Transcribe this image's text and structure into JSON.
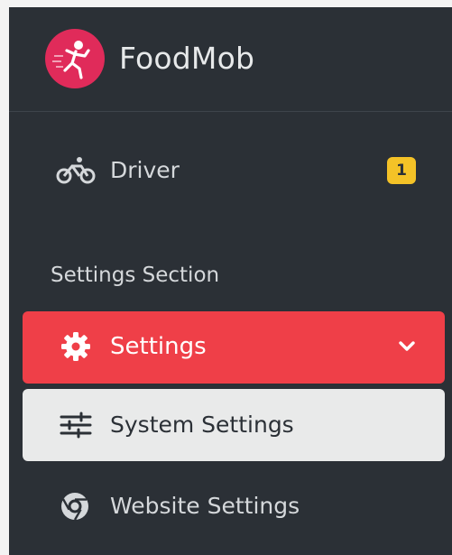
{
  "brand": {
    "name": "FoodMob",
    "logo_color": "#e02b5a"
  },
  "nav": {
    "driver": {
      "label": "Driver",
      "icon": "bicycle-icon",
      "badge": "1",
      "badge_color": "#f4c227"
    },
    "section_title": "Settings Section",
    "settings": {
      "label": "Settings",
      "icon": "gear-icon",
      "expanded": true,
      "active_color": "#ef3f48"
    },
    "system_settings": {
      "label": "System Settings",
      "icon": "sliders-icon"
    },
    "website_settings": {
      "label": "Website Settings",
      "icon": "chrome-icon"
    }
  },
  "colors": {
    "sidebar_bg": "#2b3036",
    "text": "#d5d8db"
  }
}
